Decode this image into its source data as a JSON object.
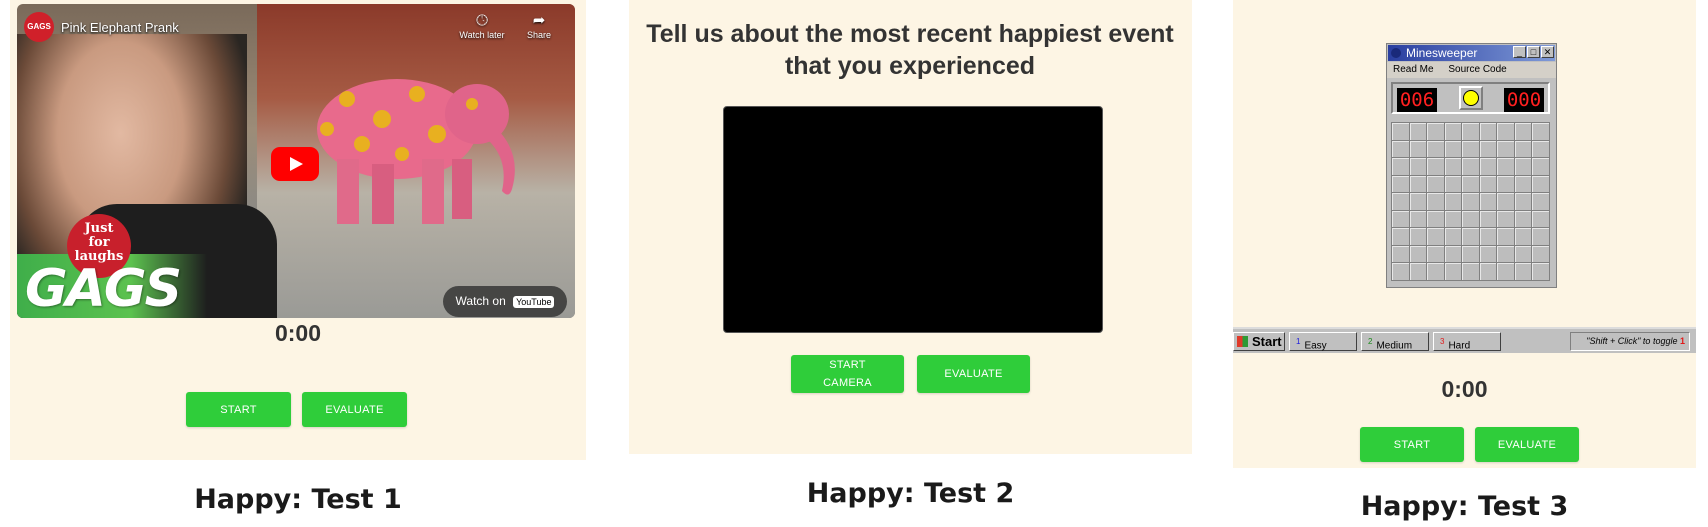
{
  "test1": {
    "video": {
      "channel_logo": "GAGS",
      "title": "Pink Elephant Prank",
      "watch_later": "Watch later",
      "share": "Share",
      "badge": "Just for laughs",
      "brand": "GAGS",
      "watch_on": "Watch on",
      "youtube": "YouTube"
    },
    "timer": "0:00",
    "start_label": "START",
    "evaluate_label": "EVALUATE",
    "caption": "Happy: Test 1"
  },
  "test2": {
    "heading": "Tell us about the most recent happiest event that you experienced",
    "start_camera_label": "START CAMERA",
    "evaluate_label": "EVALUATE",
    "caption": "Happy: Test 2"
  },
  "test3": {
    "window_title": "Minesweeper",
    "menu": [
      "Read Me",
      "Source Code"
    ],
    "mines_counter": "006",
    "time_counter": "000",
    "taskbar": {
      "start": "Start",
      "levels": [
        {
          "num": "1",
          "label": "Easy",
          "color": "#1a1ae0"
        },
        {
          "num": "2",
          "label": "Medium",
          "color": "#1a8a1a"
        },
        {
          "num": "3",
          "label": "Hard",
          "color": "#e01a1a"
        }
      ],
      "tip": "\"Shift + Click\" to toggle",
      "tip_num": "1"
    },
    "timer": "0:00",
    "start_label": "START",
    "evaluate_label": "EVALUATE",
    "caption": "Happy: Test 3"
  },
  "colors": {
    "panel_bg": "#fdf5e4",
    "button_green": "#2fcd3a"
  }
}
